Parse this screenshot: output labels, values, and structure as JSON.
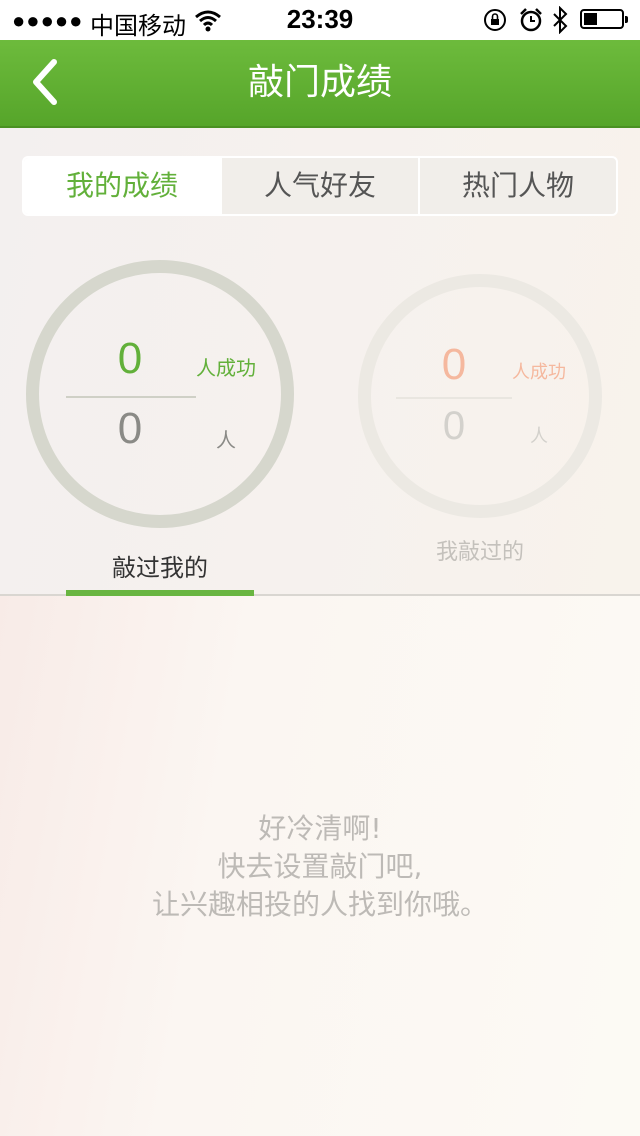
{
  "status_bar": {
    "signal": "●●●●●",
    "carrier": "中国移动",
    "time": "23:39",
    "battery_level": 0.35
  },
  "nav": {
    "title": "敲门成绩"
  },
  "tabs": [
    {
      "label": "我的成绩",
      "active": true
    },
    {
      "label": "人气好友",
      "active": false
    },
    {
      "label": "热门人物",
      "active": false
    }
  ],
  "stats": {
    "knocked_me": {
      "success": "0",
      "success_unit": "人成功",
      "total": "0",
      "total_unit": "人",
      "label": "敲过我的",
      "selected": true
    },
    "i_knocked": {
      "success": "0",
      "success_unit": "人成功",
      "total": "0",
      "total_unit": "人",
      "label": "我敲过的",
      "selected": false
    }
  },
  "empty_message": {
    "line1": "好冷清啊!",
    "line2": "快去设置敲门吧,",
    "line3": "让兴趣相投的人找到你哦。"
  },
  "colors": {
    "brand_green": "#62b03a",
    "accent_orange": "#f5b89e"
  },
  "icons": {
    "back": "chevron-left-icon",
    "wifi": "wifi-icon",
    "rotation_lock": "rotation-lock-icon",
    "alarm": "alarm-icon",
    "bluetooth": "bluetooth-icon",
    "battery": "battery-icon"
  }
}
